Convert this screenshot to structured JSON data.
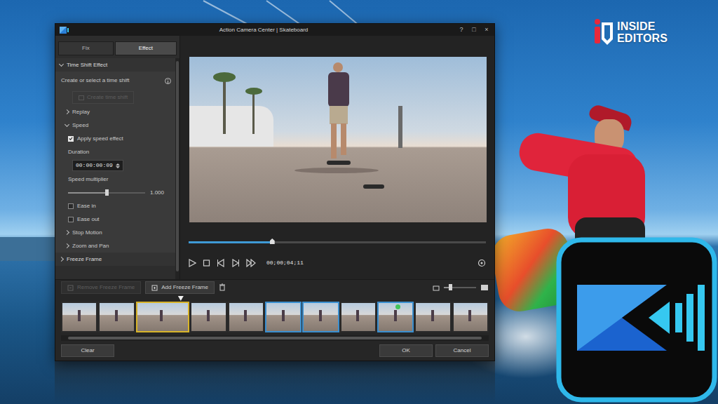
{
  "brand": {
    "line1": "INSIDE",
    "line2": "EDITORS"
  },
  "window": {
    "title": "Action Camera Center | Skateboard",
    "controls": [
      "?",
      "□",
      "×"
    ]
  },
  "tabs": [
    {
      "label": "Fix",
      "selected": false
    },
    {
      "label": "Effect",
      "selected": true
    }
  ],
  "panel": {
    "items": [
      {
        "kind": "header",
        "label": "Time Shift Effect",
        "expanded": true
      },
      {
        "kind": "note",
        "label": "Create or select a time shift"
      },
      {
        "kind": "button",
        "label": "Create time shift",
        "disabled": true
      },
      {
        "kind": "subheader",
        "label": "Replay",
        "expanded": false
      },
      {
        "kind": "subheader",
        "label": "Speed",
        "expanded": true
      },
      {
        "kind": "checkbox",
        "label": "Apply speed effect",
        "checked": true
      },
      {
        "kind": "label",
        "label": "Duration"
      },
      {
        "kind": "timecode",
        "value": "00:00:00:09"
      },
      {
        "kind": "label",
        "label": "Speed multiplier"
      },
      {
        "kind": "slider",
        "level": 0.5,
        "reading": "1.000"
      },
      {
        "kind": "checkbox",
        "label": "Ease in",
        "checked": false
      },
      {
        "kind": "checkbox",
        "label": "Ease out",
        "checked": false
      },
      {
        "kind": "subheader",
        "label": "Stop Motion",
        "expanded": false
      },
      {
        "kind": "subheader",
        "label": "Zoom and Pan",
        "expanded": false
      },
      {
        "kind": "header",
        "label": "Freeze Frame",
        "expanded": false
      }
    ]
  },
  "player": {
    "scrub_level": 0.28,
    "timecode": "00;00;04;11"
  },
  "freeze": {
    "buttons": [
      {
        "label": "Remove Freeze Frame",
        "disabled": true
      },
      {
        "label": "Add Freeze Frame",
        "disabled": false
      }
    ],
    "zoom_level": 0.2
  },
  "filmstrip": {
    "playhead_level": 0.28,
    "frames": [
      {
        "kind": "plain",
        "marker": false
      },
      {
        "kind": "plain",
        "marker": false
      },
      {
        "kind": "selected",
        "marker": false
      },
      {
        "kind": "plain",
        "marker": false
      },
      {
        "kind": "plain",
        "marker": false
      },
      {
        "kind": "freeze",
        "marker": false
      },
      {
        "kind": "freeze",
        "marker": false
      },
      {
        "kind": "plain",
        "marker": false
      },
      {
        "kind": "freeze",
        "marker": true
      },
      {
        "kind": "plain",
        "marker": false
      },
      {
        "kind": "plain",
        "marker": false
      }
    ]
  },
  "footer": {
    "left": [
      "Clear"
    ],
    "right": [
      "OK",
      "Cancel"
    ]
  }
}
